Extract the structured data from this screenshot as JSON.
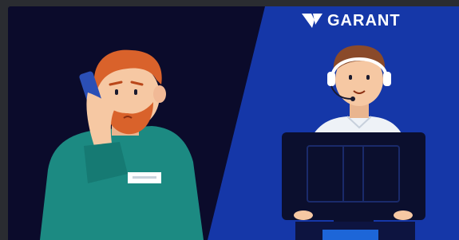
{
  "brand": {
    "name": "GARANT",
    "logo_icon": "garant-v-logo-icon"
  },
  "scene": {
    "left_panel": {
      "description_icon": "customer-on-phone-illustration",
      "colors": {
        "background": "#0b0b2b",
        "shirt": "#1c8a82",
        "hair": "#d9622b",
        "skin": "#f6c8a3",
        "phone": "#2b4fb6"
      }
    },
    "right_panel": {
      "description_icon": "support-agent-headset-illustration",
      "colors": {
        "background": "#1537a8",
        "shirt": "#eef2f7",
        "hair": "#8a4a2a",
        "monitor": "#0b0f2e"
      }
    }
  }
}
